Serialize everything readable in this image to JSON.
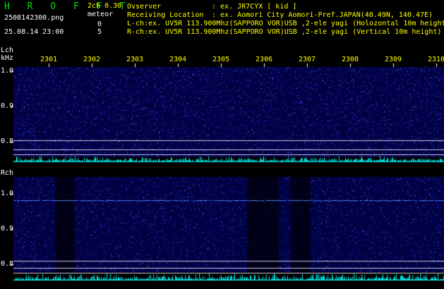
{
  "header": {
    "title": "H R O F F T",
    "mode": "2ch 0.30",
    "meteor_label": "meteor",
    "meteor_counts": [
      "0",
      "5"
    ],
    "filename": "2508142300.png",
    "datetime": "25.08.14 23:00"
  },
  "info": [
    {
      "key": "Ovserver",
      "value": ": ex. JR7CYX [ kid ]"
    },
    {
      "key": "Receiving Location",
      "value": ": ex. Aomori City Aomori-Pref.JAPAN(40.49N, 140.47E)"
    },
    {
      "text": "L-ch:ex. UV5R 113.900Mhz(SAPPORO VOR)USB ,2-ele yagi (Holozontal 10m height)"
    },
    {
      "text": "R-ch:ex. UV5R 113.900Mhz(SAPPORO VOR)USB ,2-ele yagi (Vertical 10m height)"
    }
  ],
  "time_ticks": [
    "2301",
    "2302",
    "2303",
    "2304",
    "2305",
    "2306",
    "2307",
    "2308",
    "2309",
    "2310"
  ],
  "channels": [
    {
      "name": "Lch",
      "unit": "kHz",
      "freq_ticks": [
        "1.0",
        "0.9",
        "0.8"
      ]
    },
    {
      "name": "Rch",
      "unit": "",
      "freq_ticks": [
        "1.0",
        "0.9",
        "0.8"
      ]
    }
  ],
  "colors": {
    "background": "#000000",
    "waterfall_base": "#000040",
    "noise": "#1a1ab0",
    "signal_line": "#4a80ff",
    "amplitude": "#00e0e0",
    "title": "#00e000",
    "info": "#ffff00",
    "tick_text": "#ffff00"
  }
}
